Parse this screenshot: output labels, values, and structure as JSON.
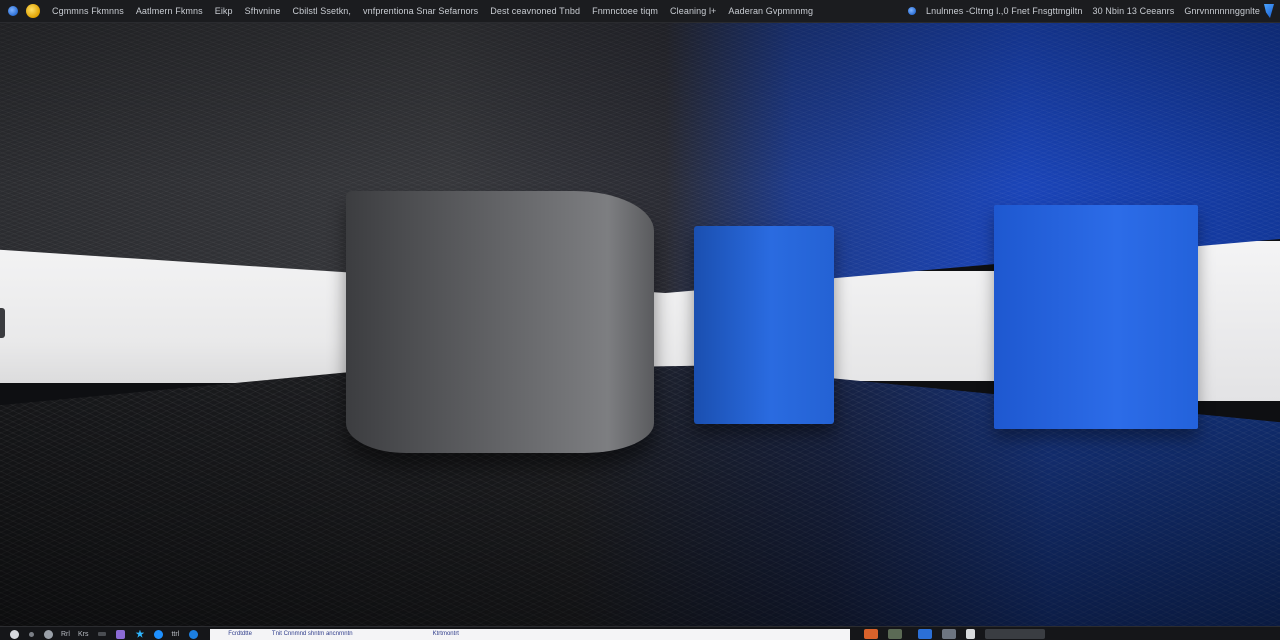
{
  "menubar": {
    "left_items": [
      "Cgmmns Fkmnns",
      "Aatlmern Fkmns",
      "Eikp",
      "Sfhvnine",
      "Cbilstl Ssetkn,",
      "vnfprentiona Snar Sefarnors",
      "Dest ceavnoned Tnbd",
      "Fnmnctoee tiqm",
      "Cleaning l+",
      "Aaderan Gvpmnnmg"
    ],
    "right_items": [
      "Lnulnnes -Cltrng l.,0 Fnet Fnsgttmgiltn",
      "30 Nbin 13 Ceeanrs",
      "Gnrvnnnnnnggnlte"
    ]
  },
  "taskbar": {
    "labels": [
      "Rrl",
      "Krs",
      "ttrl"
    ],
    "search_text_1": "Fcrdtdtte",
    "search_text_2": "Tnit Cnnmnd shntm ancnrnntn",
    "search_text_3": "Ktrtmontrt"
  },
  "colors": {
    "accent_blue": "#2a6be0",
    "menubar_bg": "#1b1c1f"
  }
}
